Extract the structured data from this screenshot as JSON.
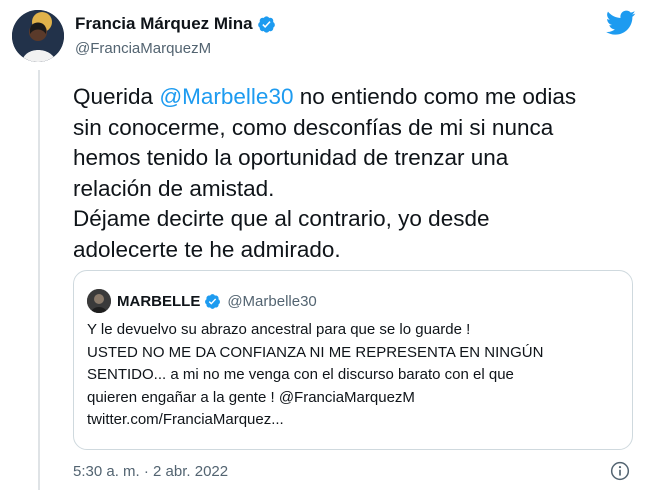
{
  "author": {
    "display_name": "Francia Márquez Mina",
    "handle": "@FranciaMarquezM"
  },
  "tweet": {
    "text_before": "Querida ",
    "mention": "@Marbelle30",
    "text_after": " no entiendo como me odias\nsin conocerme, como desconfías de mi si nunca\nhemos tenido la oportunidad de trenzar una\nrelación de amistad.\nDéjame decirte que al contrario, yo desde\nadolecerte te he admirado."
  },
  "quoted": {
    "display_name": "MARBELLE",
    "handle": "@Marbelle30",
    "text": "Y le devuelvo su abrazo ancestral para que se lo guarde !\nUSTED NO ME DA CONFIANZA NI ME REPRESENTA EN NINGÚN\nSENTIDO... a mi no me venga con el discurso barato con el que\nquieren engañar a la gente ! @FranciaMarquezM\ntwitter.com/FranciaMarquez..."
  },
  "meta": {
    "timestamp": "5:30 a. m. · 2 abr. 2022"
  },
  "icons": {
    "brand": "twitter-bird-icon",
    "verified": "verified-badge-icon",
    "info": "info-icon"
  },
  "colors": {
    "accent": "#1d9bf0",
    "text": "#0f1419",
    "muted": "#536471",
    "border": "#cfd9de"
  }
}
